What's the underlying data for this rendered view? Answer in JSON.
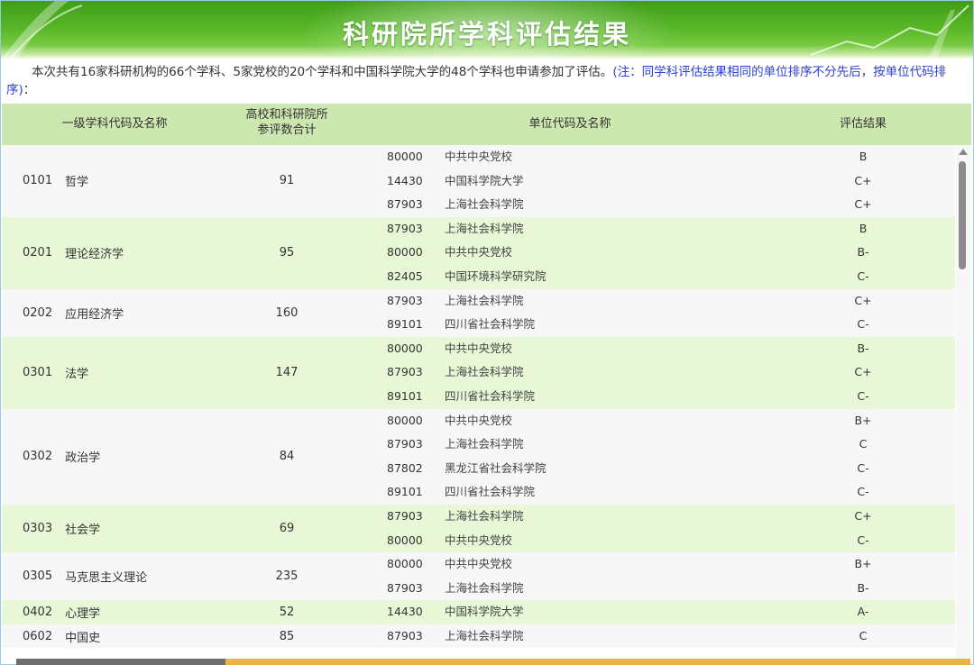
{
  "title": "科研院所学科评估结果",
  "intro_text": "本次共有16家科研机构的66个学科、5家党校的20个学科和中国科学院大学的48个学科也申请参加了评估。",
  "intro_note": "(注：同学科评估结果相同的单位排序不分先后，按单位代码排序)",
  "intro_colon": "：",
  "headers": {
    "subject": "一级学科代码及名称",
    "count_line1": "高校和科研院所",
    "count_line2": "参评数合计",
    "unit": "单位代码及名称",
    "result": "评估结果"
  },
  "groups": [
    {
      "code": "0101",
      "name": "哲学",
      "count": "91",
      "units": [
        {
          "code": "80000",
          "name": "中共中央党校",
          "result": "B"
        },
        {
          "code": "14430",
          "name": "中国科学院大学",
          "result": "C+"
        },
        {
          "code": "87903",
          "name": "上海社会科学院",
          "result": "C+"
        }
      ]
    },
    {
      "code": "0201",
      "name": "理论经济学",
      "count": "95",
      "units": [
        {
          "code": "87903",
          "name": "上海社会科学院",
          "result": "B"
        },
        {
          "code": "80000",
          "name": "中共中央党校",
          "result": "B-"
        },
        {
          "code": "82405",
          "name": "中国环境科学研究院",
          "result": "C-"
        }
      ]
    },
    {
      "code": "0202",
      "name": "应用经济学",
      "count": "160",
      "units": [
        {
          "code": "87903",
          "name": "上海社会科学院",
          "result": "C+"
        },
        {
          "code": "89101",
          "name": "四川省社会科学院",
          "result": "C-"
        }
      ]
    },
    {
      "code": "0301",
      "name": "法学",
      "count": "147",
      "units": [
        {
          "code": "80000",
          "name": "中共中央党校",
          "result": "B-"
        },
        {
          "code": "87903",
          "name": "上海社会科学院",
          "result": "C+"
        },
        {
          "code": "89101",
          "name": "四川省社会科学院",
          "result": "C-"
        }
      ]
    },
    {
      "code": "0302",
      "name": "政治学",
      "count": "84",
      "units": [
        {
          "code": "80000",
          "name": "中共中央党校",
          "result": "B+"
        },
        {
          "code": "87903",
          "name": "上海社会科学院",
          "result": "C"
        },
        {
          "code": "87802",
          "name": "黑龙江省社会科学院",
          "result": "C-"
        },
        {
          "code": "89101",
          "name": "四川省社会科学院",
          "result": "C-"
        }
      ]
    },
    {
      "code": "0303",
      "name": "社会学",
      "count": "69",
      "units": [
        {
          "code": "87903",
          "name": "上海社会科学院",
          "result": "C+"
        },
        {
          "code": "80000",
          "name": "中共中央党校",
          "result": "C-"
        }
      ]
    },
    {
      "code": "0305",
      "name": "马克思主义理论",
      "count": "235",
      "units": [
        {
          "code": "80000",
          "name": "中共中央党校",
          "result": "B+"
        },
        {
          "code": "87903",
          "name": "上海社会科学院",
          "result": "B-"
        }
      ]
    },
    {
      "code": "0402",
      "name": "心理学",
      "count": "52",
      "units": [
        {
          "code": "14430",
          "name": "中国科学院大学",
          "result": "A-"
        }
      ]
    },
    {
      "code": "0602",
      "name": "中国史",
      "count": "85",
      "units": [
        {
          "code": "87903",
          "name": "上海社会科学院",
          "result": "C"
        }
      ]
    }
  ]
}
